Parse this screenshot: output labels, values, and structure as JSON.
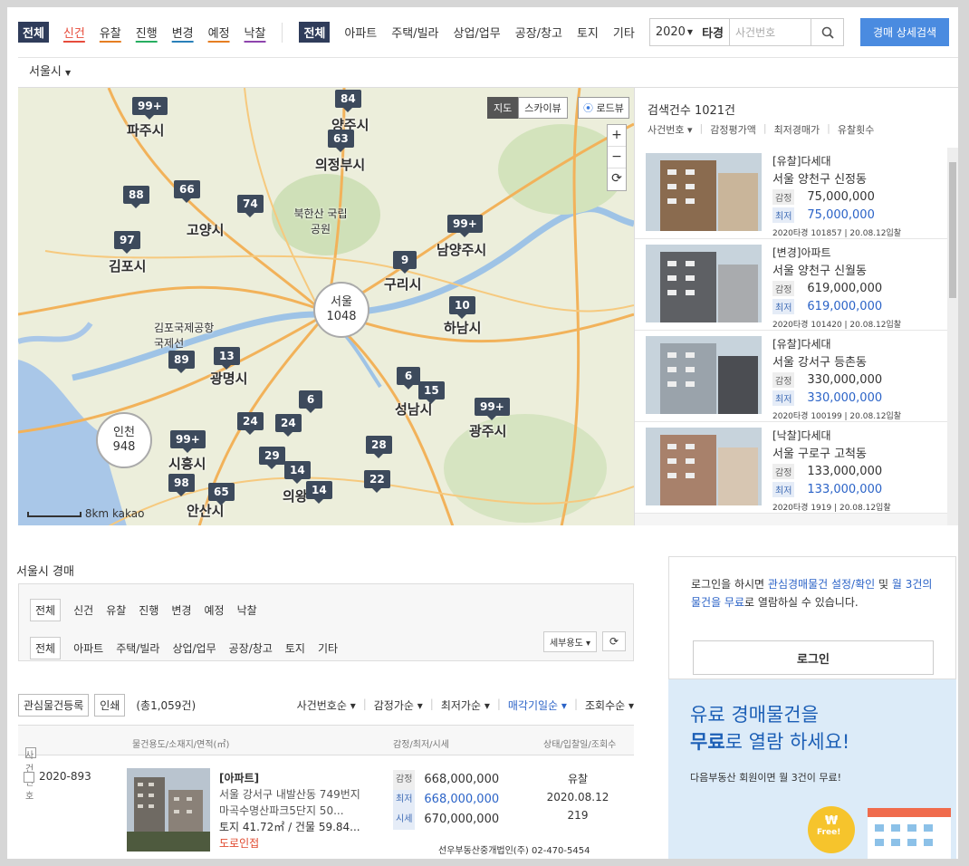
{
  "top_filters": {
    "status_all": "전체",
    "status": [
      {
        "label": "신건",
        "color": "#e74c3c"
      },
      {
        "label": "유찰",
        "color": "#e67e22"
      },
      {
        "label": "진행",
        "color": "#27ae60"
      },
      {
        "label": "변경",
        "color": "#2980b9"
      },
      {
        "label": "예정",
        "color": "#e67e22"
      },
      {
        "label": "낙찰",
        "color": "#8e44ad"
      }
    ],
    "type_all": "전체",
    "types": [
      "아파트",
      "주택/빌라",
      "상업/업무",
      "공장/창고",
      "토지",
      "기타"
    ],
    "year": "2020",
    "court": "타경",
    "case_placeholder": "사건번호",
    "detail_search": "경매 상세검색"
  },
  "region": "서울시",
  "map": {
    "view_map": "지도",
    "view_sky": "스카이뷰",
    "roadview": "로드뷰",
    "zoom_in": "+",
    "zoom_out": "−",
    "scale": "8km",
    "brand": "kakao",
    "cities": [
      "파주시",
      "양주시",
      "의정부시",
      "고양시",
      "김포시",
      "남양주시",
      "구리시",
      "하남시",
      "인천",
      "광명시",
      "성남시",
      "광주시",
      "시흥시",
      "안산시",
      "의왕",
      "북한산 국립공원",
      "김포국제공항 국제선"
    ],
    "clusters": [
      "99+",
      "84",
      "63",
      "88",
      "66",
      "74",
      "97",
      "9",
      "99+",
      "10",
      "89",
      "13",
      "6",
      "15",
      "6",
      "99+",
      "24",
      "24",
      "28",
      "99+",
      "29",
      "14",
      "14",
      "98",
      "65",
      "22"
    ],
    "big": [
      {
        "name": "서울",
        "count": "1048"
      },
      {
        "name": "인천",
        "count": "948"
      }
    ]
  },
  "list_panel": {
    "count_label": "검색건수 1021건",
    "sorts": [
      "사건번호",
      "감정평가액",
      "최저경매가",
      "유찰횟수"
    ],
    "items": [
      {
        "type": "[유찰]다세대",
        "addr": "서울 양천구 신정동",
        "appraisal_label": "감정",
        "appraisal": "75,000,000",
        "min_label": "최저",
        "min": "75,000,000",
        "meta": "2020타경 101857 | 20.08.12입찰"
      },
      {
        "type": "[변경]아파트",
        "addr": "서울 양천구 신월동",
        "appraisal_label": "감정",
        "appraisal": "619,000,000",
        "min_label": "최저",
        "min": "619,000,000",
        "meta": "2020타경 101420 | 20.08.12입찰"
      },
      {
        "type": "[유찰]다세대",
        "addr": "서울 강서구 등촌동",
        "appraisal_label": "감정",
        "appraisal": "330,000,000",
        "min_label": "최저",
        "min": "330,000,000",
        "meta": "2020타경 100199 | 20.08.12입찰"
      },
      {
        "type": "[낙찰]다세대",
        "addr": "서울 구로구 고척동",
        "appraisal_label": "감정",
        "appraisal": "133,000,000",
        "min_label": "최저",
        "min": "133,000,000",
        "meta": "2020타경 1919 | 20.08.12입찰"
      }
    ]
  },
  "section": {
    "title": "서울시 경매",
    "status": [
      "전체",
      "신건",
      "유찰",
      "진행",
      "변경",
      "예정",
      "낙찰"
    ],
    "types": [
      "전체",
      "아파트",
      "주택/빌라",
      "상업/업무",
      "공장/창고",
      "토지",
      "기타"
    ],
    "detail_btn": "세부용도",
    "refresh": "⟳",
    "watch_btn": "관심물건등록",
    "print_btn": "인쇄",
    "total": "(총1,059건)",
    "sorts": [
      "사건번호순",
      "감정가순",
      "최저가순",
      "매각기일순",
      "조회수순"
    ],
    "cols": [
      "사건번호",
      "물건용도/소재지/면적(㎡)",
      "감정/최저/시세",
      "상태/입찰일/조회수"
    ]
  },
  "row": {
    "case": "2020-893",
    "type": "[아파트]",
    "addr1": "서울 강서구 내발산동 749번지",
    "addr2": "마곡수명산파크5단지 50...",
    "area": "토지 41.72㎡ / 건물 59.84...",
    "road": "도로인접",
    "p1_label": "감정",
    "p1": "668,000,000",
    "p2_label": "최저",
    "p2": "668,000,000",
    "p3_label": "시세",
    "p3": "670,000,000",
    "status": "유찰",
    "date": "2020.08.12",
    "views": "219",
    "broker": "선우부동산중개법인(주) 02-470-5454"
  },
  "login": {
    "text_pre": "로그인을 하시면 ",
    "text_link1": "관심경매물건 설정/확인",
    "text_mid": " 및 ",
    "text_link2": "월 3건의 물건을 무료",
    "text_post": "로 열람하실 수 있습니다.",
    "button": "로그인"
  },
  "promo": {
    "line1": "유료 경매물건을",
    "line2_bold": "무료",
    "line2_rest": "로 열람 하세요!",
    "sub": "다음부동산 회원이면 월 3건이 무료!",
    "badge": "Free!"
  }
}
